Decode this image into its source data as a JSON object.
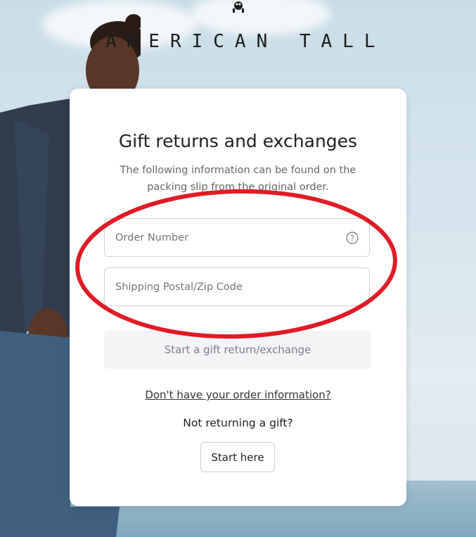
{
  "brand": {
    "name": "AMERICAN TALL"
  },
  "form": {
    "title": "Gift returns and exchanges",
    "subtitle": "The following information can be found on the packing slip from the original order.",
    "order_number_placeholder": "Order Number",
    "zip_placeholder": "Shipping Postal/Zip Code",
    "submit_label": "Start a gift return/exchange",
    "no_info_link": "Don't have your order information?",
    "not_returning_text": "Not returning a gift?",
    "start_here_label": "Start here"
  },
  "icons": {
    "help": "question-circle-icon",
    "logo": "brand-logo-icon"
  },
  "colors": {
    "annotation": "#e01b24",
    "primary_button_bg": "#f3f4f6"
  }
}
